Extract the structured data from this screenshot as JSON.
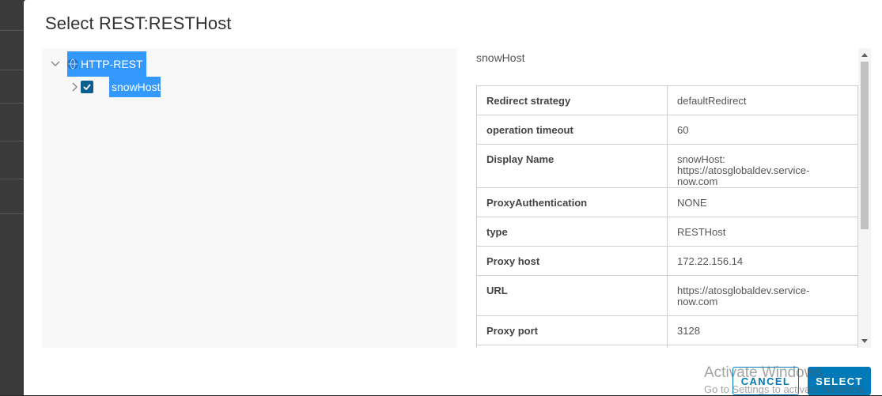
{
  "dialog": {
    "title": "Select REST:RESTHost"
  },
  "tree": {
    "root": {
      "label": "HTTP-REST",
      "expanded": true,
      "icon": "globe-icon"
    },
    "child": {
      "label": "snowHost",
      "checked": true,
      "expanded": false
    }
  },
  "detail": {
    "title": "snowHost",
    "properties": [
      {
        "key": "Redirect strategy",
        "value": "defaultRedirect"
      },
      {
        "key": "operation timeout",
        "value": "60"
      },
      {
        "key": "Display Name",
        "value": "snowHost: https://atosglobaldev.service-now.com"
      },
      {
        "key": "ProxyAuthentication",
        "value": "NONE"
      },
      {
        "key": "type",
        "value": "RESTHost"
      },
      {
        "key": "Proxy host",
        "value": "172.22.156.14"
      },
      {
        "key": "URL",
        "value": "https://atosglobaldev.service-now.com"
      },
      {
        "key": "Proxy port",
        "value": "3128"
      },
      {
        "key": "",
        "value": ""
      }
    ]
  },
  "buttons": {
    "cancel": "CANCEL",
    "select": "SELECT"
  },
  "watermark": {
    "line1": "Activate Windows",
    "line2": "Go to Settings to activate Windows."
  },
  "colors": {
    "selection": "#3399ff",
    "primary": "#0079b8",
    "checkbox": "#0b5f90"
  }
}
